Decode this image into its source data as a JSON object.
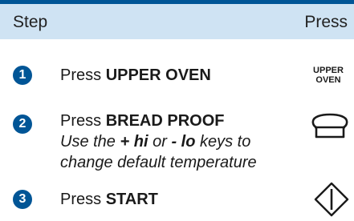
{
  "header": {
    "step_col": "Step",
    "press_col": "Press"
  },
  "steps": [
    {
      "number": "1",
      "verb": "Press",
      "key": "UPPER OVEN",
      "key_label_line1": "UPPER",
      "key_label_line2": "OVEN"
    },
    {
      "number": "2",
      "verb": "Press",
      "key": "BREAD PROOF",
      "note_prefix": "Use the",
      "note_hi": "+ hi",
      "note_or": "or",
      "note_lo": "- lo",
      "note_suffix": "keys to",
      "note_line2": "change default temperature",
      "icon": "bread-loaf-icon"
    },
    {
      "number": "3",
      "verb": "Press",
      "key": "START",
      "icon": "start-diamond-icon"
    }
  ],
  "colors": {
    "accent": "#005596",
    "header_bg": "#cfe3f3"
  }
}
